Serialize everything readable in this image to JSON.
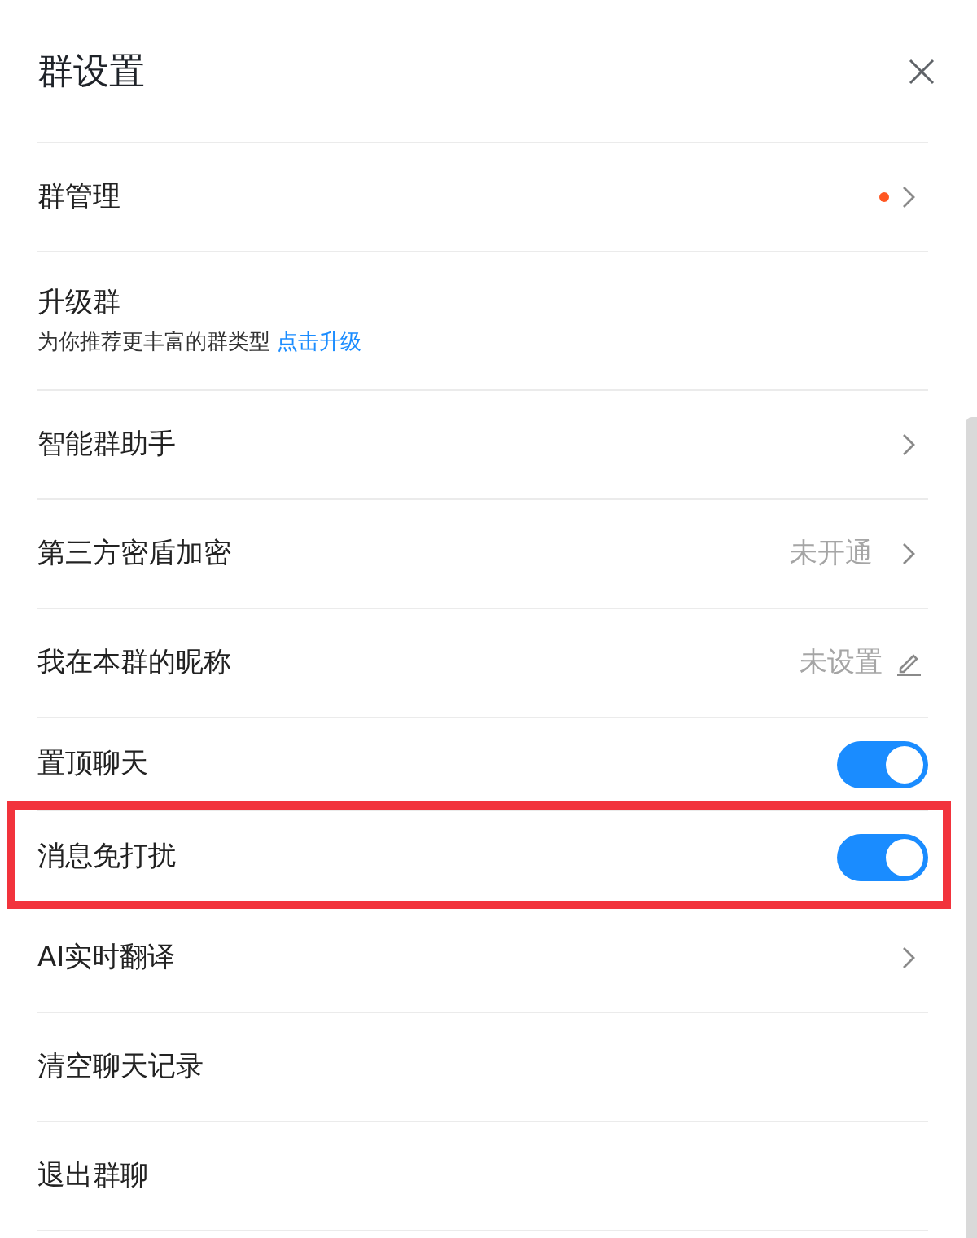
{
  "title": "群设置",
  "rows": [
    {
      "kind": "link",
      "label": "群管理",
      "unread": true,
      "highlighted": false
    },
    {
      "kind": "upgrade",
      "label": "升级群",
      "description": "为你推荐更丰富的群类型",
      "link": "点击升级",
      "highlighted": false
    },
    {
      "kind": "link",
      "label": "智能群助手",
      "unread": false,
      "highlighted": false
    },
    {
      "kind": "link",
      "label": "第三方密盾加密",
      "value": "未开通",
      "unread": false,
      "highlighted": false
    },
    {
      "kind": "edit",
      "label": "我在本群的昵称",
      "value": "未设置",
      "highlighted": false
    },
    {
      "kind": "toggle",
      "label": "置顶聊天",
      "on": true,
      "highlighted": false
    },
    {
      "kind": "toggle",
      "label": "消息免打扰",
      "on": true,
      "highlighted": true
    },
    {
      "kind": "link",
      "label": "AI实时翻译",
      "unread": false,
      "highlighted": false
    },
    {
      "kind": "plain",
      "label": "清空聊天记录",
      "highlighted": false
    },
    {
      "kind": "plain",
      "label": "退出群聊",
      "highlighted": false
    }
  ]
}
